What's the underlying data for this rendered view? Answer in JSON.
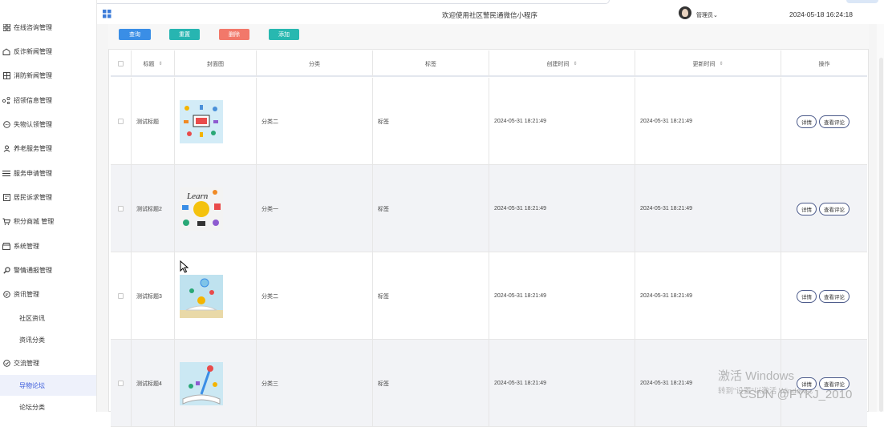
{
  "header": {
    "title": "欢迎使用社区警民通微信小程序",
    "user": "管理员",
    "datetime": "2024-05-18 16:24:18"
  },
  "sidebar": {
    "items": [
      {
        "label": "在线咨询管理",
        "icon": "grid-icon"
      },
      {
        "label": "反诈新闻管理",
        "icon": "home-icon"
      },
      {
        "label": "消防新闻管理",
        "icon": "columns-icon"
      },
      {
        "label": "招领信息管理",
        "icon": "share-icon"
      },
      {
        "label": "失物认领管理",
        "icon": "chat-icon"
      },
      {
        "label": "养老服务管理",
        "icon": "user-icon"
      },
      {
        "label": "服务申请管理",
        "icon": "list-icon"
      },
      {
        "label": "居民诉求管理",
        "icon": "form-icon"
      },
      {
        "label": "积分商城 管理",
        "icon": "cart-icon"
      },
      {
        "label": "系统管理",
        "icon": "store-icon"
      },
      {
        "label": "警情通报管理",
        "icon": "search-icon"
      },
      {
        "label": "资讯管理",
        "icon": "message-icon"
      },
      {
        "label": "社区资讯",
        "icon": ""
      },
      {
        "label": "资讯分类",
        "icon": ""
      },
      {
        "label": "交流管理",
        "icon": "check-circle-icon"
      },
      {
        "label": "导物论坛",
        "icon": ""
      },
      {
        "label": "论坛分类",
        "icon": ""
      }
    ]
  },
  "toolbar": {
    "query": "查询",
    "reset": "重置",
    "delete": "删除",
    "add": "添加"
  },
  "table": {
    "columns": {
      "title": "标题",
      "cover": "封面图",
      "category": "分类",
      "tags": "标签",
      "created": "创建时间",
      "updated": "更新时间",
      "actions": "操作"
    },
    "rows": [
      {
        "title": "测试标题",
        "category": "分类二",
        "tags": "标签",
        "created": "2024-05-31 18:21:49",
        "updated": "2024-05-31 18:21:49"
      },
      {
        "title": "测试标题2",
        "category": "分类一",
        "tags": "标签",
        "created": "2024-05-31 18:21:49",
        "updated": "2024-05-31 18:21:49"
      },
      {
        "title": "测试标题3",
        "category": "分类二",
        "tags": "标签",
        "created": "2024-05-31 18:21:49",
        "updated": "2024-05-31 18:21:49"
      },
      {
        "title": "测试标题4",
        "category": "分类三",
        "tags": "标签",
        "created": "2024-05-31 18:21:49",
        "updated": "2024-05-31 18:21:49"
      }
    ],
    "detail_label": "详情",
    "comments_label": "查看评论"
  },
  "watermark": {
    "line1": "激活 Windows",
    "line2": "转到\"设置\"以激活 Windows。",
    "csdn": "CSDN @FYKJ_2010"
  },
  "colors": {
    "query": "#3a8ee6",
    "reset": "#27b5b1",
    "delete": "#f2786a",
    "add": "#28b8b0",
    "active_menu_bg": "#eef1fb",
    "active_menu_text": "#3b5bdb"
  }
}
